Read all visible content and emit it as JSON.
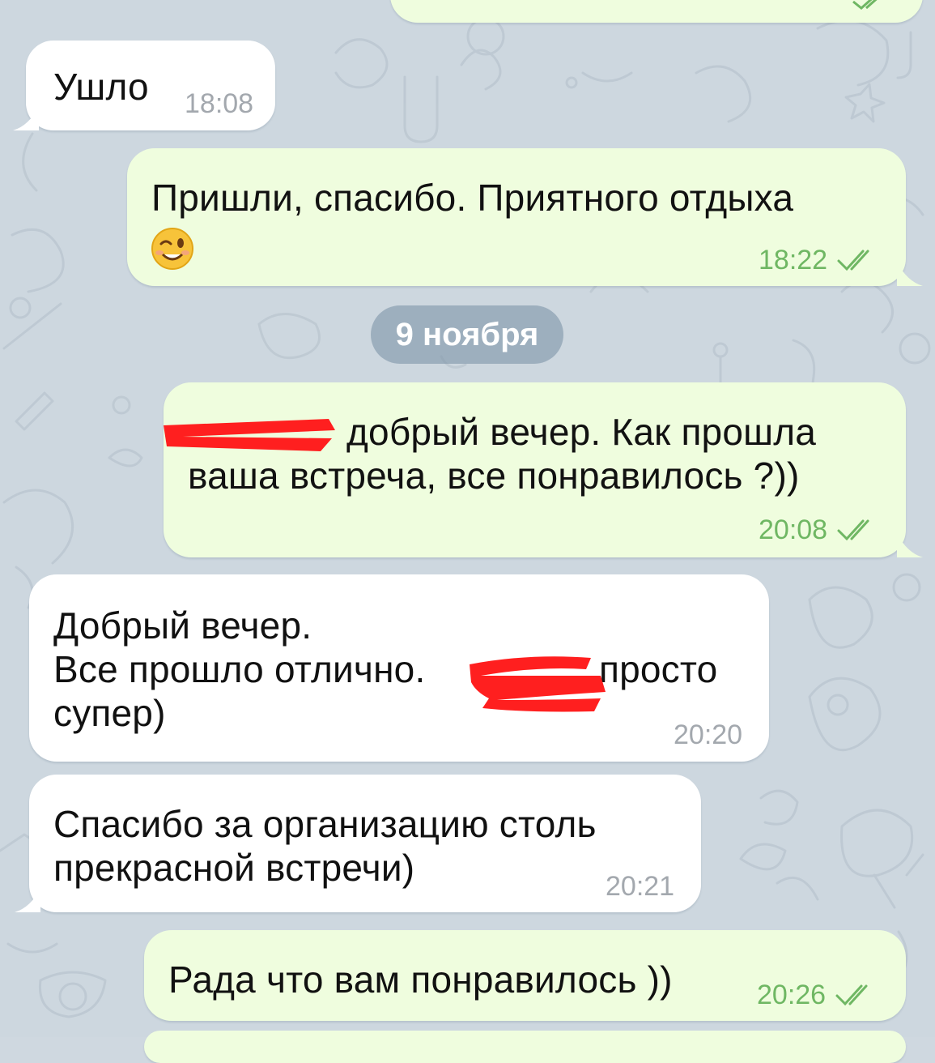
{
  "chat": {
    "date_separator": "9 ноября",
    "messages": [
      {
        "direction": "in",
        "text": "Ушло",
        "time": "18:08"
      },
      {
        "direction": "out",
        "text": "Пришли, спасибо. Приятного отдыха",
        "emoji": "winking-face",
        "time": "18:22",
        "status": "read"
      },
      {
        "direction": "out",
        "text": "добрый вечер. Как прошла\nваша встреча, все понравилось ?))",
        "time": "20:08",
        "status": "read",
        "redacted_fragment": true
      },
      {
        "direction": "in",
        "text": "Добрый вечер.\nВсе прошло отлично. ",
        "text_after_redaction": "просто",
        "text_line3": "супер)",
        "time": "20:20",
        "redacted_fragment": true
      },
      {
        "direction": "in",
        "text": "Спасибо за организацию столь\nпрекрасной встречи)",
        "time": "20:21"
      },
      {
        "direction": "out",
        "text": "Рада что вам понравилось ))",
        "time": "20:26",
        "status": "read"
      }
    ]
  },
  "colors": {
    "background": "#cdd7df",
    "outgoing_bubble": "#effdde",
    "incoming_bubble": "#ffffff",
    "outgoing_time": "#6fb763",
    "incoming_time": "#a3a8ae",
    "date_pill": "#8096aa",
    "redaction_mark": "#ff1f1f"
  },
  "icons": {
    "read_status": "double-check-icon",
    "emoji": "winking-face-emoji-icon"
  }
}
